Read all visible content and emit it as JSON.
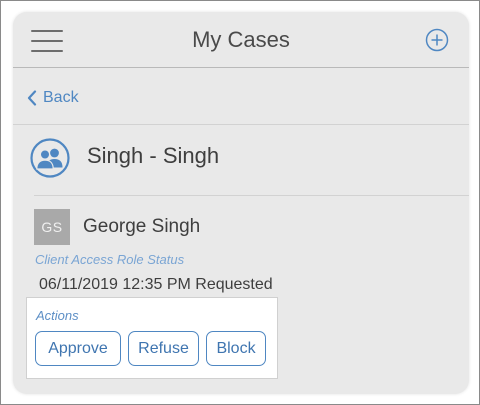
{
  "header": {
    "title": "My Cases",
    "menu_icon": "hamburger-menu-icon",
    "add_icon": "plus-circle-icon"
  },
  "nav": {
    "back_label": "Back",
    "back_icon": "chevron-left-icon"
  },
  "case": {
    "title": "Singh - Singh",
    "icon": "people-group-icon"
  },
  "person": {
    "initials": "GS",
    "name": "George Singh",
    "status_label": "Client Access Role Status",
    "status_value": "06/11/2019 12:35 PM Requested"
  },
  "actions": {
    "label": "Actions",
    "buttons": [
      "Approve",
      "Refuse",
      "Block"
    ]
  },
  "colors": {
    "accent": "#4f87c2",
    "panel_background": "#e9e9e9",
    "label_blue": "#7aa5d4",
    "avatar_gray": "#a9a9a9",
    "text": "#3e3e3e"
  }
}
